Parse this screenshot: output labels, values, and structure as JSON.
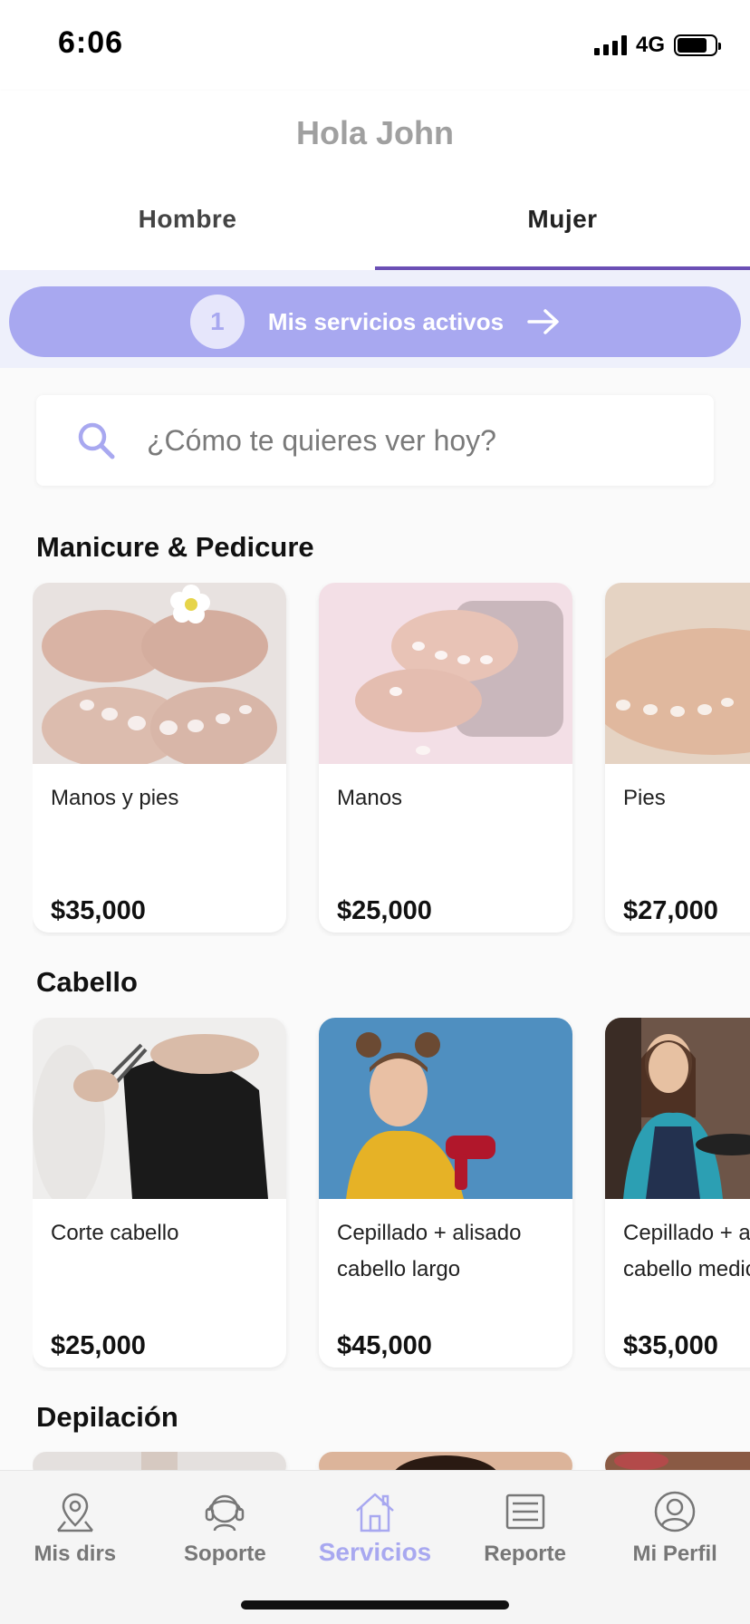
{
  "status": {
    "time": "6:06",
    "network": "4G",
    "battery_level": 0.8
  },
  "header": {
    "greeting": "Hola John",
    "tabs": [
      {
        "label": "Hombre",
        "active": false
      },
      {
        "label": "Mujer",
        "active": true
      }
    ]
  },
  "banner": {
    "count": "1",
    "label": "Mis servicios activos",
    "icon": "arrow-right-icon"
  },
  "search": {
    "placeholder": "¿Cómo te quieres ver hoy?",
    "value": "",
    "icon": "search-icon"
  },
  "sections": [
    {
      "title": "Manicure & Pedicure",
      "cards": [
        {
          "name": "Manos y pies",
          "price": "$35,000"
        },
        {
          "name": "Manos",
          "price": "$25,000"
        },
        {
          "name": "Pies",
          "price": "$27,000"
        }
      ]
    },
    {
      "title": "Cabello",
      "cards": [
        {
          "name": "Corte cabello",
          "price": "$25,000"
        },
        {
          "name": "Cepillado + alisado cabello largo",
          "price": "$45,000"
        },
        {
          "name": "Cepillado + alisado cabello medio",
          "price": "$35,000"
        }
      ]
    },
    {
      "title": "Depilación",
      "cards": []
    }
  ],
  "bottom_nav": [
    {
      "label": "Mis dirs",
      "icon": "map-pin-icon",
      "active": false
    },
    {
      "label": "Soporte",
      "icon": "headset-icon",
      "active": false
    },
    {
      "label": "Servicios",
      "icon": "home-icon",
      "active": true
    },
    {
      "label": "Reporte",
      "icon": "list-icon",
      "active": false
    },
    {
      "label": "Mi Perfil",
      "icon": "user-icon",
      "active": false
    }
  ],
  "colors": {
    "accent": "#a8a8f0",
    "tab_underline": "#6b4fb5",
    "muted": "#a0a0a0"
  }
}
